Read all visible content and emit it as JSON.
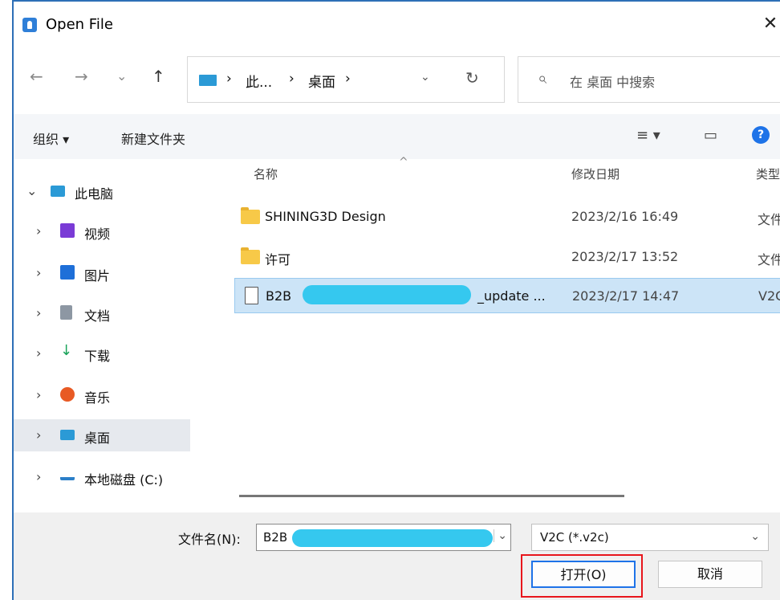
{
  "window": {
    "title": "Open File",
    "close": "✕"
  },
  "nav": {
    "back": "←",
    "forward": "→",
    "recent": "⌄",
    "up": "↑",
    "breadcrumb": [
      "此...",
      "桌面"
    ],
    "breadcrumb_sep": "›",
    "dropdown": "⌄",
    "refresh": "↻",
    "search_placeholder": "在 桌面 中搜索"
  },
  "toolbar": {
    "organize": "组织 ▾",
    "new_folder": "新建文件夹",
    "view": "≡ ▾",
    "preview": "▭",
    "help": "?"
  },
  "sidebar": {
    "items": [
      {
        "label": "此电脑",
        "chevron": "⌄",
        "color": "#2b9ad6"
      },
      {
        "label": "视频",
        "chevron": "›",
        "color": "#7a3bd6"
      },
      {
        "label": "图片",
        "chevron": "›",
        "color": "#1e6fd8"
      },
      {
        "label": "文档",
        "chevron": "›",
        "color": "#8d97a3"
      },
      {
        "label": "下载",
        "chevron": "›",
        "color": "#1aa35a"
      },
      {
        "label": "音乐",
        "chevron": "›",
        "color": "#e85a24"
      },
      {
        "label": "桌面",
        "chevron": "›",
        "color": "#2b9ad6"
      },
      {
        "label": "本地磁盘 (C:)",
        "chevron": "›",
        "color": "#2b7fc8"
      }
    ]
  },
  "filelist": {
    "headers": {
      "name": "名称",
      "date": "修改日期",
      "type": "类型"
    },
    "sort_caret": "^",
    "rows": [
      {
        "name": "SHINING3D Design",
        "date": "2023/2/16 16:49",
        "type": "文件",
        "kind": "folder"
      },
      {
        "name": "许可",
        "date": "2023/2/17 13:52",
        "type": "文件",
        "kind": "folder"
      },
      {
        "name": "B2B",
        "name_tail": "_update ...",
        "date": "2023/2/17 14:47",
        "type": "V2C",
        "kind": "file"
      }
    ]
  },
  "bottom": {
    "filename_label": "文件名(N):",
    "filename_value": "B2B",
    "dropdown_arrow": "⌄",
    "filetype": "V2C (*.v2c)",
    "open_label": "打开(O)",
    "cancel_label": "取消"
  },
  "colors": {
    "accent": "#1e73e8",
    "highlight_box": "#e8161c",
    "redaction": "#35c8ef",
    "selected_row": "#cce4f7"
  }
}
